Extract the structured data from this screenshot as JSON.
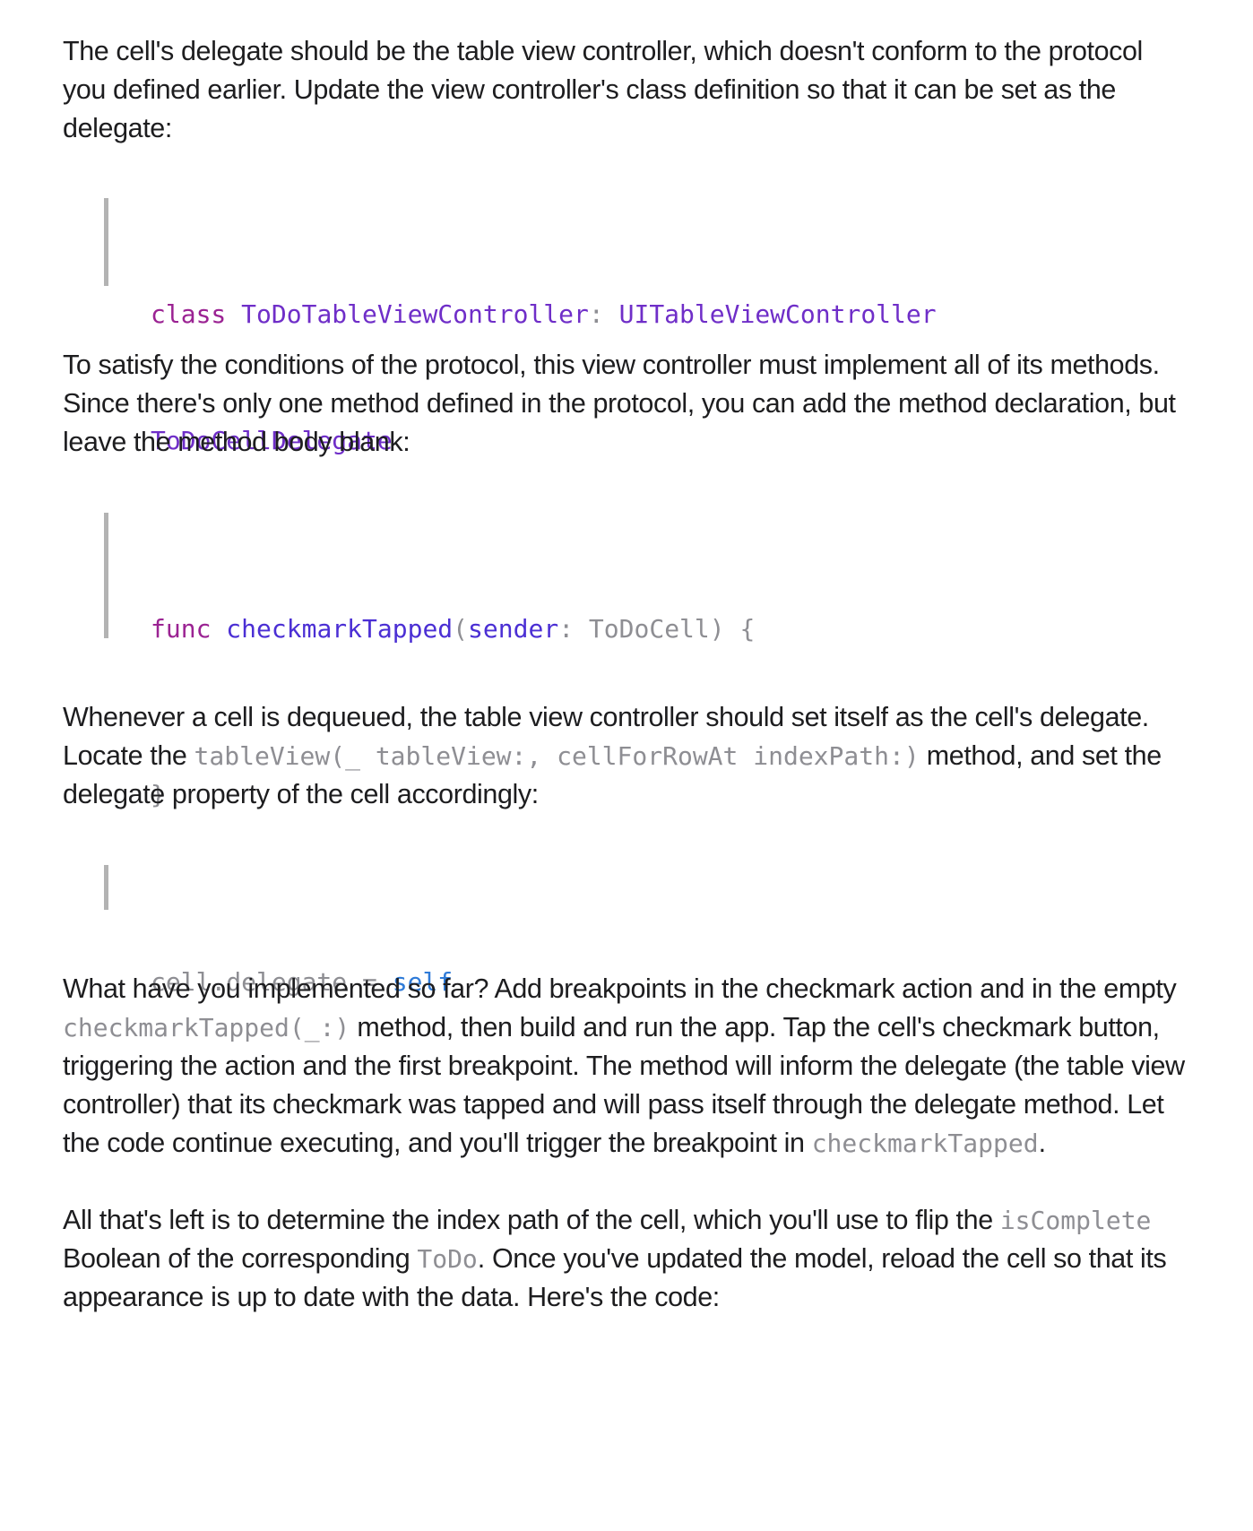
{
  "paragraphs": {
    "p1": "The cell's delegate should be the table view controller, which doesn't conform to the protocol you defined earlier. Update the view controller's class definition so that it can be set as the delegate:",
    "p2": "To satisfy the conditions of the protocol, this view controller must implement all of its methods. Since there's only one method defined in the protocol, you can add the method declaration, but leave the method body blank:",
    "p3": {
      "before": "Whenever a cell is dequeued, the table view controller should set itself as the cell's delegate. Locate the ",
      "code": "tableView(_ tableView:, cellForRowAt indexPath:)",
      "after": " method, and set the delegate property of the cell accordingly:"
    },
    "p4": {
      "t1": "What have you implemented so far? Add breakpoints in the checkmark action and in the empty ",
      "c1": "checkmarkTapped(_:)",
      "t2": " method, then build and run the app. Tap the cell's checkmark button, triggering the action and the first breakpoint. The method will inform the delegate (the table view controller) that its checkmark was tapped and will pass itself through the delegate method. Let the code continue executing, and you'll trigger the breakpoint in ",
      "c2": "checkmarkTapped",
      "t3": "."
    },
    "p5": {
      "t1": "All that's left is to determine the index path of the cell, which you'll use to flip the ",
      "c1": "isComplete",
      "t2": " Boolean of the corresponding ",
      "c2": "ToDo",
      "t3": ". Once you've updated the model, reload the cell so that its appearance is up to date with the data. Here's the code:"
    }
  },
  "code1": {
    "kw_class": "class",
    "class_name": "ToDoTableViewController",
    "colon": ":",
    "superclass": "UITableViewController",
    "protocol": "ToDoCellDelegate"
  },
  "code2": {
    "kw_func": "func",
    "method_name": "checkmarkTapped",
    "open_paren": "(",
    "param_label": "sender",
    "colon_type": ": ToDoCell) {",
    "close_brace": "}"
  },
  "code3": {
    "lhs": "cell.delegate",
    "eq": " = ",
    "rhs": "self"
  }
}
